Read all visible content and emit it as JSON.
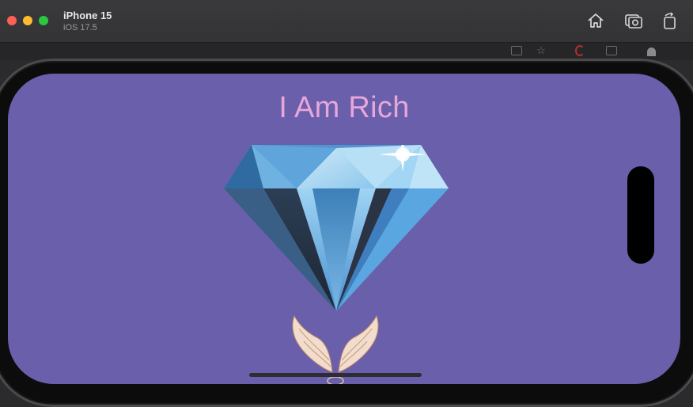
{
  "simulator": {
    "device_name": "iPhone 15",
    "os_version": "iOS 17.5",
    "toolbar_icons": [
      "home-icon",
      "screenshot-icon",
      "rotate-icon"
    ]
  },
  "app": {
    "title": "I Am Rich",
    "background_color": "#6a5faa",
    "title_color": "#e7a6d9",
    "images": [
      "diamond-image",
      "angel-wings-image"
    ]
  }
}
